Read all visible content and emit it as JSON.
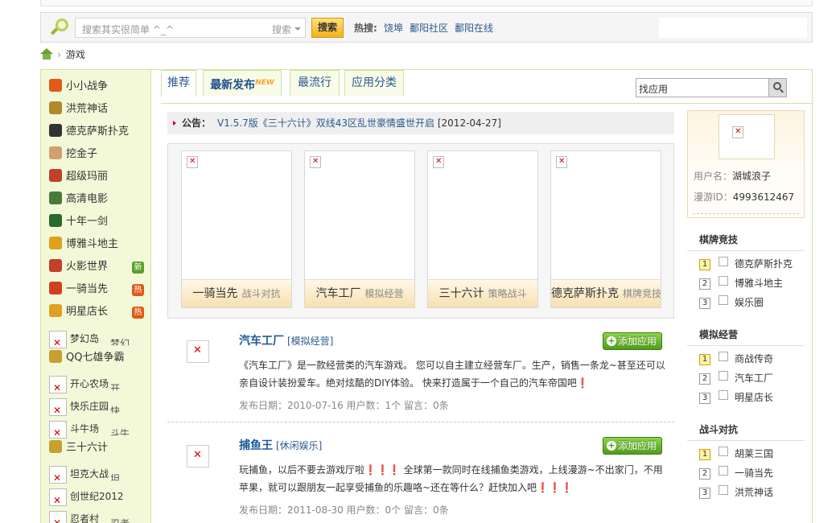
{
  "search": {
    "placeholder": "搜索其实很简单 ^_^",
    "type": "搜索",
    "button": "搜索",
    "hot_label": "热搜:",
    "hot_links": [
      "饶埠",
      "鄱阳社区",
      "鄱阳在线"
    ]
  },
  "breadcrumb": {
    "current": "游戏"
  },
  "left_games": [
    {
      "name": "小小战争",
      "icon": "war-icon",
      "color": "#e05a1a"
    },
    {
      "name": "洪荒神话",
      "icon": "myth-icon",
      "color": "#b08a2a"
    },
    {
      "name": "德克萨斯扑克",
      "icon": "poker-icon",
      "color": "#333333"
    },
    {
      "name": "挖金子",
      "icon": "gold-icon",
      "color": "#d0a070"
    },
    {
      "name": "超级玛丽",
      "icon": "mario-icon",
      "color": "#c0402a"
    },
    {
      "name": "高清电影",
      "icon": "film-icon",
      "color": "#4a7a3a"
    },
    {
      "name": "十年一剑",
      "icon": "sword-icon",
      "color": "#2a6a2a"
    },
    {
      "name": "博雅斗地主",
      "icon": "landlord-icon",
      "color": "#e0a020"
    },
    {
      "name": "火影世界",
      "icon": "ninja-icon",
      "color": "#c0402a",
      "badge": "新",
      "badge_color": "#5aa02a"
    },
    {
      "name": "一骑当先",
      "icon": "rider-icon",
      "color": "#d04020",
      "badge": "热",
      "badge_color": "#e05a1a"
    },
    {
      "name": "明星店长",
      "icon": "star-shop-icon",
      "color": "#e0a020",
      "badge": "热",
      "badge_color": "#e05a1a"
    }
  ],
  "left_more": [
    {
      "name": "梦幻岛",
      "broken": true,
      "suffix": "梦幻"
    },
    {
      "name": "QQ七雄争霸",
      "broken": false
    },
    {
      "name": "开心农场",
      "broken": true,
      "suffix": "开"
    },
    {
      "name": "快乐庄园",
      "broken": true,
      "suffix": "快"
    },
    {
      "name": "斗牛场",
      "broken": true,
      "suffix": "斗牛"
    },
    {
      "name": "三十六计",
      "broken": false
    },
    {
      "name": "坦克大战",
      "broken": true,
      "suffix": "坦"
    },
    {
      "name": "创世纪2012",
      "broken": true
    },
    {
      "name": "忍者村",
      "broken": true,
      "suffix": "忍者"
    }
  ],
  "tabs": [
    {
      "label": "推荐"
    },
    {
      "label": "最新发布",
      "new": "NEW"
    },
    {
      "label": "最流行"
    },
    {
      "label": "应用分类"
    }
  ],
  "find_app": {
    "value": "找应用"
  },
  "notice": {
    "label": "公告：",
    "text": "V1.5.7版《三十六计》双线43区乱世豪情盛世开启",
    "date": "[2012-04-27]"
  },
  "featured": [
    {
      "name": "一骑当先",
      "category": "战斗对抗"
    },
    {
      "name": "汽车工厂",
      "category": "模拟经营"
    },
    {
      "name": "三十六计",
      "category": "策略战斗"
    },
    {
      "name": "德克萨斯扑克",
      "category": "棋牌竞技"
    }
  ],
  "apps": [
    {
      "name": "汽车工厂",
      "category": "[模拟经营]",
      "add": "添加应用",
      "desc": "《汽车工厂》是一款经营类的汽车游戏。 您可以自主建立经营车厂。生产，销售一条龙~甚至还可以亲自设计装扮爱车。绝对炫酷的DIY体验。 快来打造属于一个自己的汽车帝国吧❗",
      "meta": "发布日期：2010-07-16 用户数：1个   留言：0条"
    },
    {
      "name": "捕鱼王",
      "category": "[休闲娱乐]",
      "add": "添加应用",
      "desc": "玩捕鱼，以后不要去游戏厅啦❗❗❗ 全球第一款同时在线捕鱼类游戏，上线漫游~不出家门，不用苹果，就可以跟朋友一起享受捕鱼的乐趣咯~还在等什么？赶快加入吧❗❗❗",
      "meta": "发布日期：2011-08-30 用户数：0个   留言：0条"
    }
  ],
  "user": {
    "name_label": "用户名：",
    "name": "湖城浪子",
    "id_label": "漫游ID：",
    "id": "4993612467"
  },
  "rankings": [
    {
      "title": "棋牌竞技",
      "items": [
        "德克萨斯扑克",
        "博雅斗地主",
        "娱乐圈"
      ]
    },
    {
      "title": "模拟经营",
      "items": [
        "商战传奇",
        "汽车工厂",
        "明星店长"
      ]
    },
    {
      "title": "战斗对抗",
      "items": [
        "胡莱三国",
        "一骑当先",
        "洪荒神话"
      ]
    }
  ],
  "colors": {
    "accent": "#1d5a9a",
    "green": "#4e9c1c",
    "left_bg": "#f3f9d8"
  }
}
